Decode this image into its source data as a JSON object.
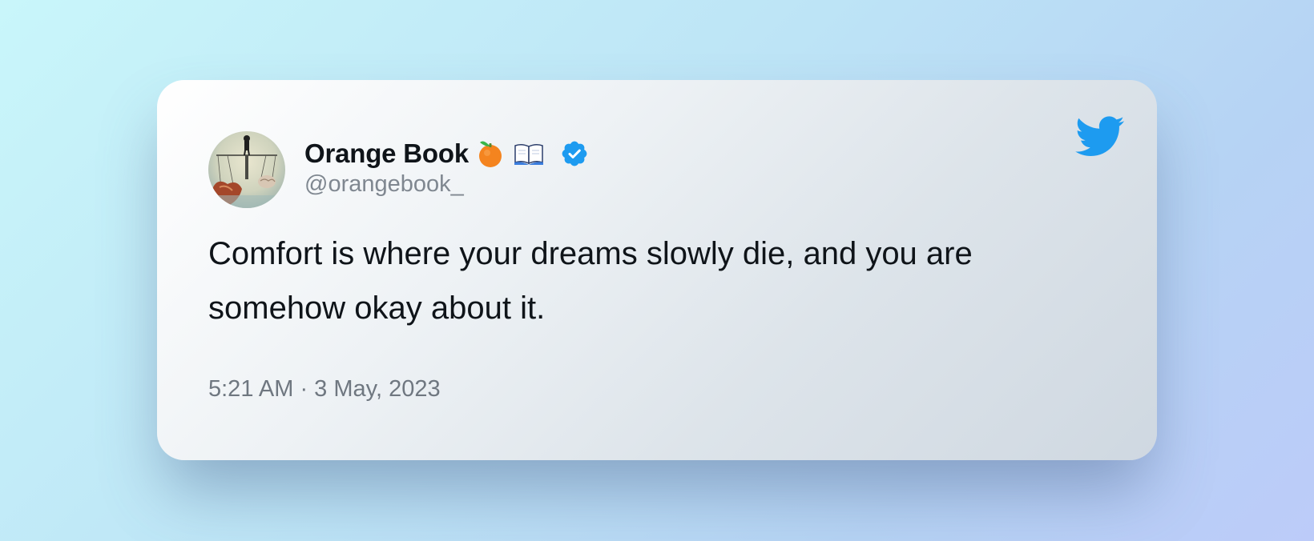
{
  "tweet": {
    "author": {
      "display_name": "Orange Book",
      "handle": "@orangebook_",
      "name_emojis": [
        "orange-emoji",
        "open-book-emoji"
      ],
      "verified": true
    },
    "text": "Comfort is where your dreams slowly die, and you are somehow okay about it.",
    "timestamp": "5:21 AM · 3 May, 2023"
  },
  "icons": {
    "brand": "twitter-bird-icon",
    "verified": "verified-badge-icon"
  },
  "colors": {
    "twitter_blue": "#1d9bf0",
    "text_primary": "#0f1419",
    "text_secondary": "#7f8790"
  }
}
